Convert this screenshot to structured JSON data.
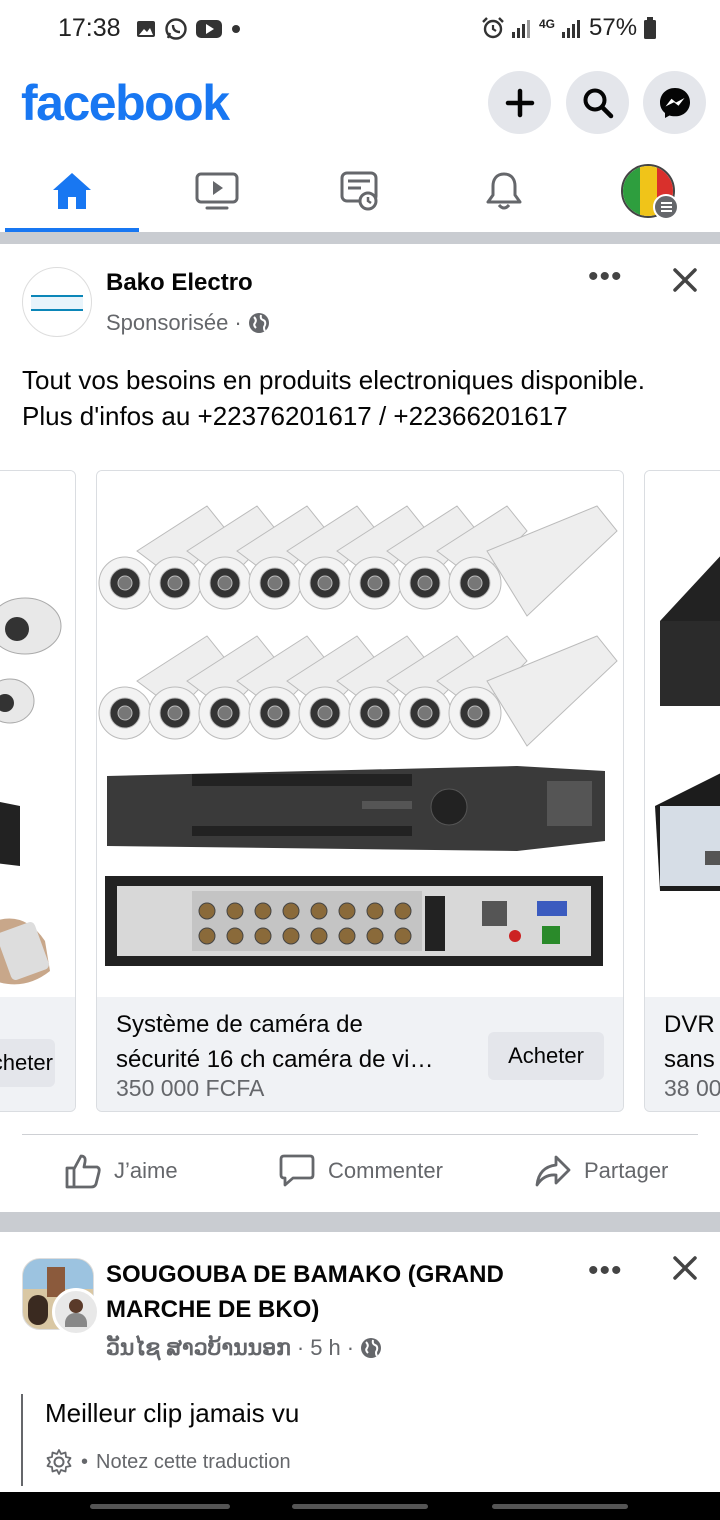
{
  "status_bar": {
    "time": "17:38",
    "network": "4G",
    "battery": "57%"
  },
  "header": {
    "logo": "facebook",
    "brand_color": "#1877f2"
  },
  "tabs": [
    {
      "name": "home",
      "active": true
    },
    {
      "name": "watch",
      "active": false
    },
    {
      "name": "memories",
      "active": false
    },
    {
      "name": "notifications",
      "active": false
    },
    {
      "name": "menu",
      "active": false
    }
  ],
  "post1": {
    "author": "Bako Electro",
    "sponsored": "Sponsorisée",
    "text_line1": "Tout vos besoins en produits electroniques disponible.",
    "text_line2": "Plus d'infos au +22376201617 / +22366201617",
    "cards": [
      {
        "buy": "Acheter"
      },
      {
        "title_line1": "Système de caméra de",
        "title_line2": "sécurité 16 ch caméra de vi…",
        "price": "350 000 FCFA",
        "buy": "Acheter"
      },
      {
        "title_line1": "DVR",
        "title_line2": "sans",
        "price": "38 00"
      }
    ],
    "actions": {
      "like": "J’aime",
      "comment": "Commenter",
      "share": "Partager"
    }
  },
  "post2": {
    "author_line1": "SOUGOUBA DE BAMAKO (GRAND",
    "author_line2": "MARCHE DE BKO)",
    "subauthor": "ວັນໄຊ ສາວບ້ານນອກ",
    "time": "5 h",
    "text": "Meilleur clip jamais vu",
    "translate": "Notez cette traduction"
  }
}
